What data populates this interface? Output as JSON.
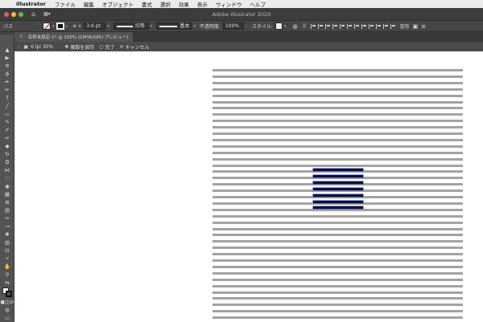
{
  "menubar": {
    "apple": "",
    "app": "Illustrator",
    "items": [
      "ファイル",
      "編集",
      "オブジェクト",
      "書式",
      "選択",
      "効果",
      "表示",
      "ウィンドウ",
      "ヘルプ"
    ]
  },
  "titlebar": {
    "title": "Adobe Illustrator 2020",
    "workspace": "▦▾"
  },
  "control_bar": {
    "label": "パス",
    "stroke_weight": "3.6 pt",
    "stroke_profile": "均等",
    "brush": "基本",
    "opacity_label": "不透明度:",
    "opacity": "100%",
    "style_label": "スタイル:",
    "transform": "変形"
  },
  "document_tab": {
    "name": "名称未設定-1* @ 150% (CMYK/GPU プレビュー)"
  },
  "isolation": {
    "layer_name": "6 lpi 30%",
    "save": "複製を保存",
    "done": "完了",
    "cancel": "キャンセル"
  },
  "tools": [
    "select-tool",
    "direct-select-tool",
    "magic-wand-tool",
    "lasso-tool",
    "pen-tool",
    "curvature-tool",
    "type-tool",
    "line-tool",
    "rectangle-tool",
    "paintbrush-tool",
    "shaper-tool",
    "pencil-tool",
    "eraser-tool",
    "rotate-tool",
    "scale-tool",
    "width-tool",
    "free-transform-tool",
    "shape-builder-tool",
    "perspective-grid-tool",
    "mesh-tool",
    "gradient-tool",
    "eyedropper-tool",
    "blend-tool",
    "symbol-sprayer-tool",
    "column-graph-tool",
    "artboard-tool",
    "slice-tool",
    "hand-tool",
    "zoom-tool",
    "fill-stroke-swatch",
    "swap-fill-stroke",
    "color-mode-buttons",
    "drawing-mode-button",
    "screen-mode-button"
  ],
  "colors": {
    "gray_line": "#a3a3a3",
    "selected_line": "#11112a",
    "selection_highlight": "#3a57e8",
    "canvas": "#ffffff",
    "pasteboard": "#535353"
  }
}
